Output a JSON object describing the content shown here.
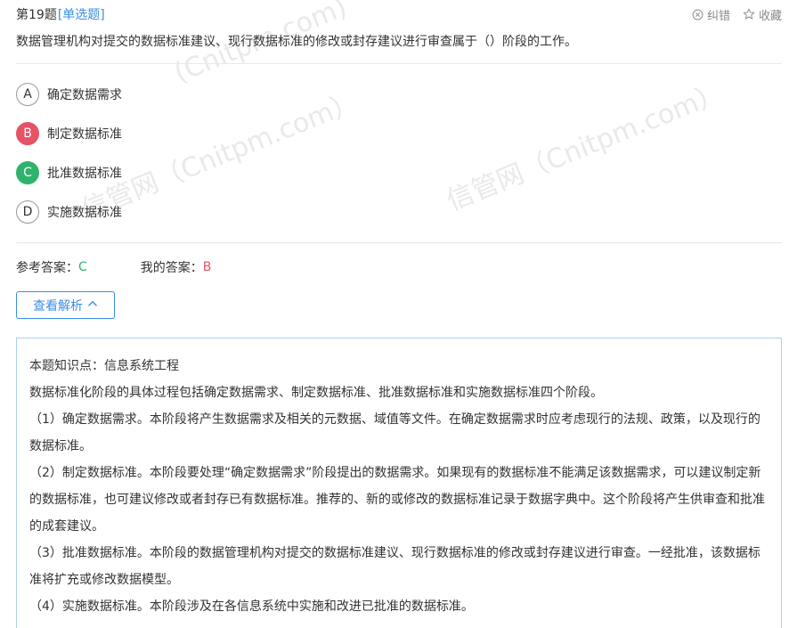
{
  "header": {
    "question_number": "第19题",
    "question_type": "[单选题]",
    "report_label": "纠错",
    "favorite_label": "收藏"
  },
  "question": {
    "stem": "数据管理机构对提交的数据标准建议、现行数据标准的修改或封存建议进行审查属于（）阶段的工作。"
  },
  "options": [
    {
      "letter": "A",
      "text": "确定数据需求",
      "state": "default"
    },
    {
      "letter": "B",
      "text": "制定数据标准",
      "state": "wrong"
    },
    {
      "letter": "C",
      "text": "批准数据标准",
      "state": "correct"
    },
    {
      "letter": "D",
      "text": "实施数据标准",
      "state": "default"
    }
  ],
  "answers": {
    "reference_label": "参考答案：",
    "reference_value": "C",
    "mine_label": "我的答案：",
    "mine_value": "B"
  },
  "toggle_button": {
    "label": "查看解析",
    "icon": "chevron-up-icon"
  },
  "analysis": {
    "lines": [
      "本题知识点：信息系统工程",
      "数据标准化阶段的具体过程包括确定数据需求、制定数据标准、批准数据标准和实施数据标准四个阶段。",
      "（1）确定数据需求。本阶段将产生数据需求及相关的元数据、域值等文件。在确定数据需求时应考虑现行的法规、政策，以及现行的数据标准。",
      "（2）制定数据标准。本阶段要处理“确定数据需求”阶段提出的数据需求。如果现有的数据标准不能满足该数据需求，可以建议制定新的数据标准，也可建议修改或者封存已有数据标准。推荐的、新的或修改的数据标准记录于数据字典中。这个阶段将产生供审查和批准的成套建议。",
      "（3）批准数据标准。本阶段的数据管理机构对提交的数据标准建议、现行数据标准的修改或封存建议进行审查。一经批准，该数据标准将扩充或修改数据模型。",
      "（4）实施数据标准。本阶段涉及在各信息系统中实施和改进已批准的数据标准。"
    ]
  },
  "watermark": {
    "text_a": "信管网（Cnitpm.com）",
    "text_b": "(Cnitpm.com)"
  },
  "colors": {
    "accent": "#3a8ee6",
    "correct": "#2fb36b",
    "wrong": "#e55366",
    "analysis_border": "#a8d3f0"
  }
}
